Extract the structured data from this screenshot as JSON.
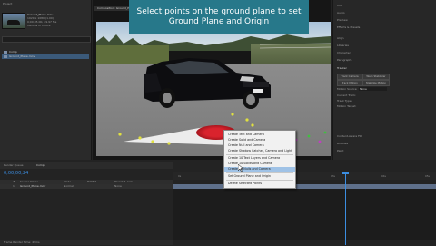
{
  "project": {
    "title": "Project",
    "comp_name": "Ground_Plane.mov",
    "comp_info": "1920 x 1080 (1.00)",
    "comp_meta": "0;00;05;00, 29.97 fps",
    "comp_extra": "Millions of Colors",
    "items": [
      {
        "name": "Comp",
        "selected": false
      },
      {
        "name": "Ground_Plane.mov",
        "selected": true
      }
    ]
  },
  "viewer": {
    "tab_label": "Composition: Ground_Plane"
  },
  "banner": {
    "line1": "Select points on the ground plane to set",
    "line2": "Ground Plane and Origin"
  },
  "right_panel": {
    "items": [
      "Info",
      "Audio",
      "Preview",
      "Effects & Presets",
      "Align",
      "Libraries",
      "Character",
      "Paragraph",
      "Tracker"
    ],
    "buttons": [
      "Track Camera",
      "Warp Stabilizer",
      "Track Motion",
      "Stabilize Motion"
    ],
    "motion_source_label": "Motion Source:",
    "motion_source_value": "None",
    "lower_items": [
      "Current Track:",
      "Track Type:",
      "Motion Target:"
    ],
    "lower2": [
      "Content-Aware Fill",
      "Brushes",
      "Paint"
    ]
  },
  "context_menu": {
    "items": [
      {
        "label": "Create Text and Camera",
        "highlight": false
      },
      {
        "label": "Create Solid and Camera",
        "highlight": false
      },
      {
        "label": "Create Null and Camera",
        "highlight": false
      },
      {
        "label": "Create Shadow Catcher, Camera and Light",
        "highlight": false
      },
      {
        "label": "Create 10 Text Layers and Camera",
        "highlight": false
      },
      {
        "label": "Create 10 Solids and Camera",
        "highlight": false
      },
      {
        "label": "Create 10 Nulls and Camera",
        "highlight": true
      },
      {
        "label": "Set Ground Plane and Origin",
        "highlight": false
      },
      {
        "label": "Delete Selected Points",
        "highlight": false
      }
    ]
  },
  "timeline": {
    "tab_label": "Render Queue",
    "comp_tab": "Comp",
    "timecode": "0;00;00;24",
    "columns": [
      "#",
      "Source Name",
      "Mode",
      "TrkMat",
      "Parent & Link"
    ],
    "layer": {
      "num": "1",
      "name": "Ground_Plane.mov",
      "mode": "Normal",
      "parent": "None"
    },
    "ruler_ticks": [
      "0s",
      "01s",
      "02s",
      "03s",
      "04s",
      "05s"
    ],
    "status": "Frame Render Time: 49ms"
  },
  "colors": {
    "banner": "#27788a",
    "timecode": "#3b8de0",
    "menu_highlight": "#9fc2e6",
    "target": "#d9232d"
  }
}
